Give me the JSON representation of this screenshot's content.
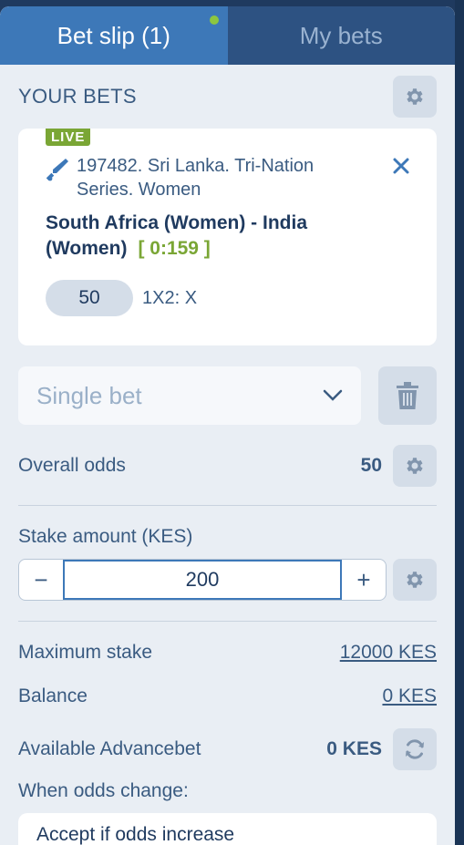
{
  "tabs": [
    {
      "label": "Bet slip (1)"
    },
    {
      "label": "My bets"
    }
  ],
  "your_bets": {
    "title": "YOUR BETS",
    "settings_icon": "gear-icon"
  },
  "bet": {
    "live_badge": "LIVE",
    "sport_icon": "cricket-bat-icon",
    "event": "197482. Sri Lanka. Tri-Nation Series. Women",
    "match": "South Africa (Women) - India (Women)",
    "score": "[ 0:159 ]",
    "coefficient": "50",
    "market": "1X2: X"
  },
  "bet_type": {
    "selected": "Single bet"
  },
  "overall_odds": {
    "label": "Overall odds",
    "value": "50"
  },
  "stake": {
    "label": "Stake amount (KES)",
    "minus": "−",
    "value": "200",
    "plus": "+"
  },
  "info": {
    "max_stake_label": "Maximum stake",
    "max_stake_value": "12000 KES",
    "balance_label": "Balance",
    "balance_value": "0 KES",
    "advancebet_label": "Available Advancebet",
    "advancebet_value": "0 KES"
  },
  "odds_change": {
    "label": "When odds change:",
    "selected": "Accept if odds increase"
  },
  "colors": {
    "accent": "#3d78b8",
    "header": "#2d5282",
    "live": "#7aa635",
    "text": "#3a5b81",
    "background": "#e9eef4"
  }
}
